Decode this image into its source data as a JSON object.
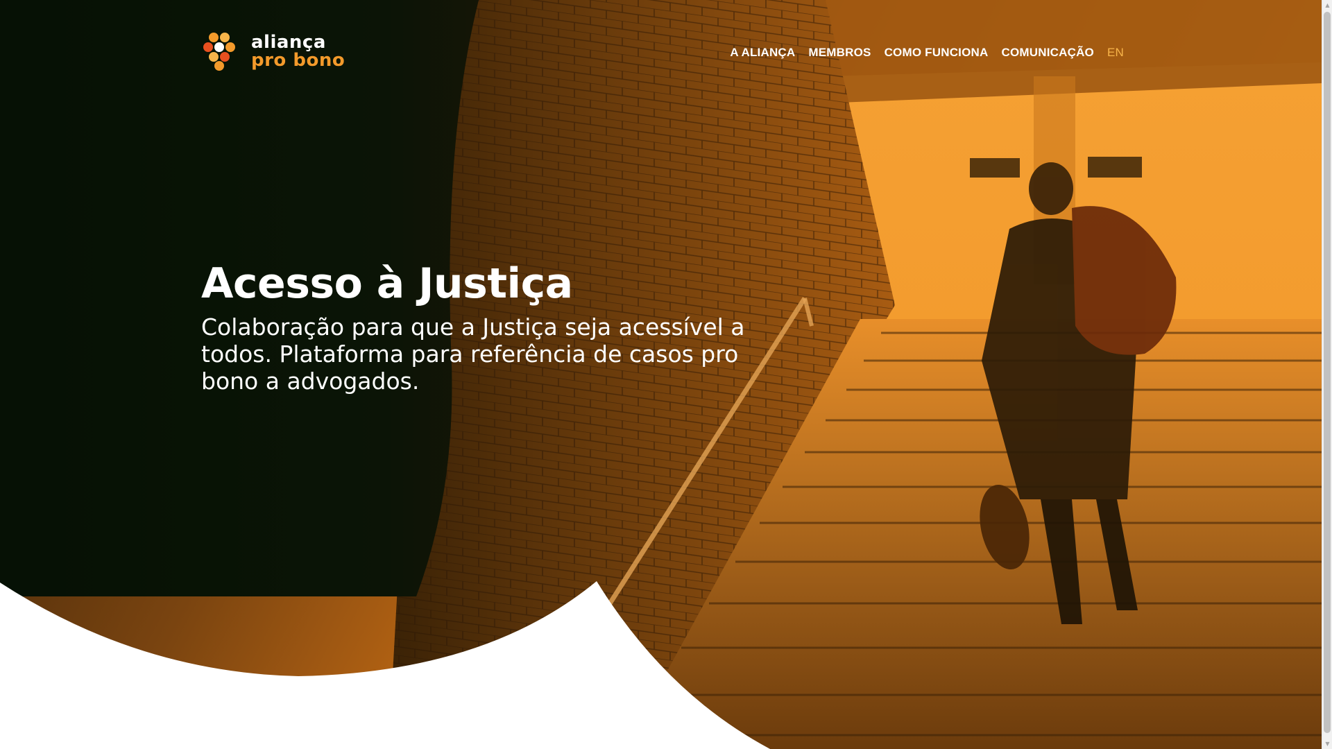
{
  "brand": {
    "name_line1": "aliança",
    "name_line2": "pro bono",
    "primary_color": "#f39a2b",
    "dark_color": "#0c1a08"
  },
  "nav": {
    "items": [
      {
        "label": "A ALIANÇA"
      },
      {
        "label": "MEMBROS"
      },
      {
        "label": "COMO FUNCIONA"
      },
      {
        "label": "COMUNICAÇÃO"
      }
    ],
    "language": "EN"
  },
  "hero": {
    "title": "Acesso à Justiça",
    "subtitle": "Colaboração para que a Justiça seja acessível a todos. Plataforma para referência de casos pro bono a advogados."
  },
  "scrollbar": {
    "up_icon": "chevron-up-icon",
    "down_icon": "chevron-down-icon"
  }
}
